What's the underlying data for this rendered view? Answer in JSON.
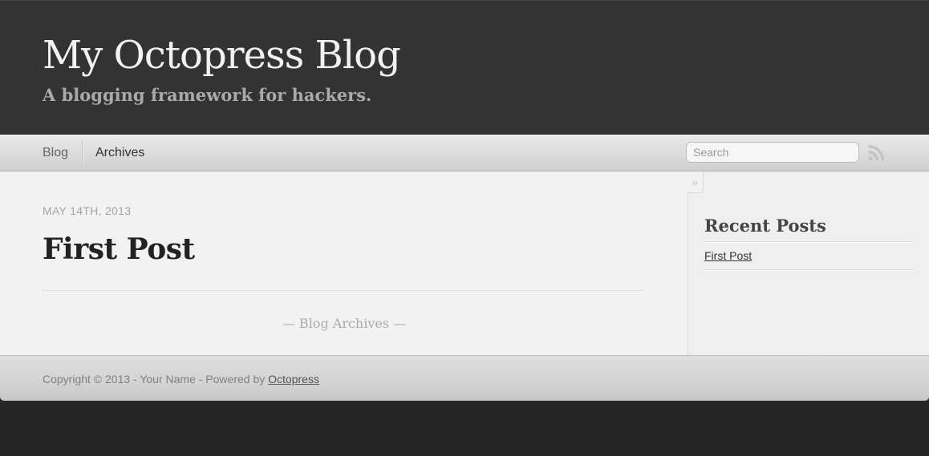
{
  "header": {
    "title": "My Octopress Blog",
    "subtitle": "A blogging framework for hackers."
  },
  "nav": {
    "items": [
      {
        "label": "Blog"
      },
      {
        "label": "Archives"
      }
    ],
    "search_placeholder": "Search",
    "rss_icon": "rss-icon"
  },
  "post": {
    "date": "May 14th, 2013",
    "title": "First Post"
  },
  "main": {
    "archives_link": "— Blog Archives —"
  },
  "sidebar": {
    "toggle_icon": "»",
    "heading": "Recent Posts",
    "posts": [
      {
        "title": "First Post"
      }
    ]
  },
  "footer": {
    "text": "Copyright © 2013 - Your Name - Powered by ",
    "link_label": "Octopress"
  },
  "colors": {
    "header_bg": "#333333",
    "nav_bg": "#dadada",
    "main_bg": "#f2f2f2",
    "footer_bg": "#d3d3d3",
    "page_bg": "#262626"
  }
}
